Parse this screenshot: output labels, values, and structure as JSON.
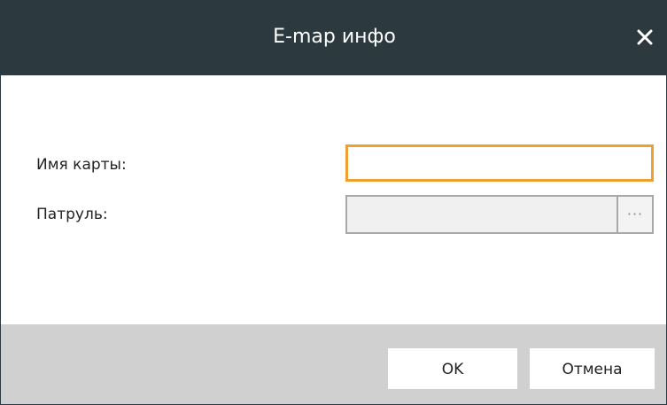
{
  "dialog": {
    "title": "E-map инфо",
    "close_icon": "close-icon"
  },
  "form": {
    "map_name_label": "Имя карты:",
    "map_name_value": "",
    "patrol_label": "Патруль:",
    "patrol_value": "",
    "browse_label": "···"
  },
  "footer": {
    "ok_label": "OK",
    "cancel_label": "Отмена"
  },
  "colors": {
    "titlebar": "#2c3a40",
    "focus_border": "#f0a030",
    "footer": "#d0d0d0"
  }
}
